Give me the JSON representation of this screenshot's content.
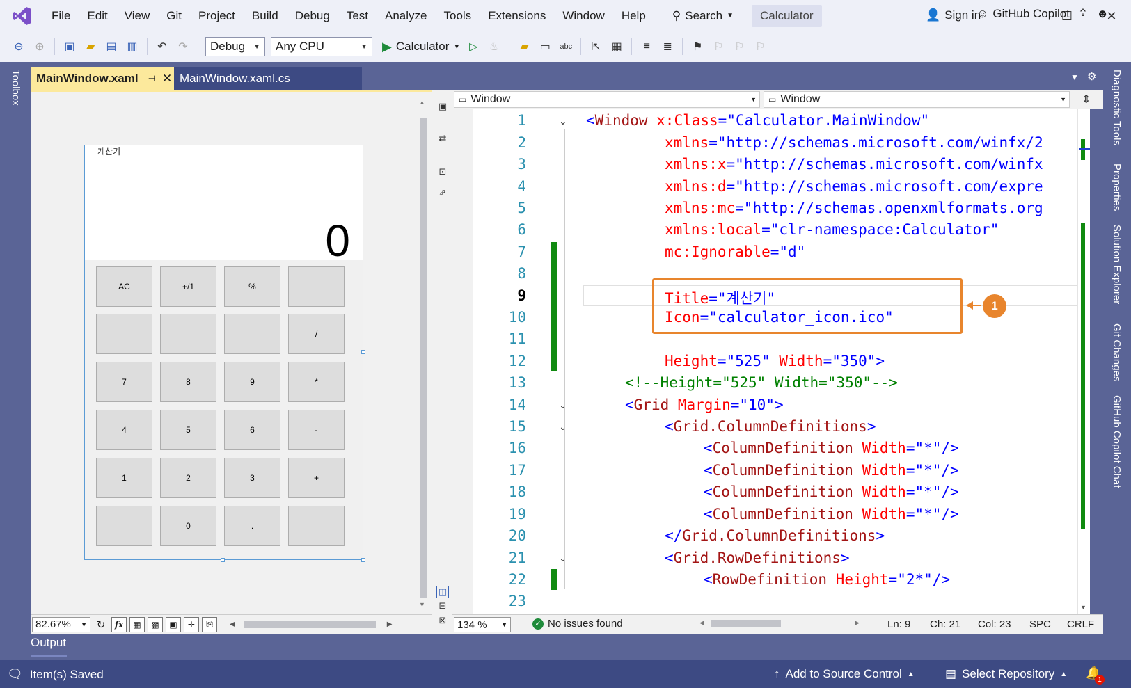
{
  "menu": {
    "items": [
      "File",
      "Edit",
      "View",
      "Git",
      "Project",
      "Build",
      "Debug",
      "Test",
      "Analyze",
      "Tools",
      "Extensions",
      "Window",
      "Help"
    ],
    "search_label": "Search",
    "solution_name": "Calculator",
    "signin_label": "Sign in"
  },
  "toolbar": {
    "config": "Debug",
    "platform": "Any CPU",
    "run_target": "Calculator",
    "copilot_label": "GitHub Copilot"
  },
  "tabs": {
    "active": "MainWindow.xaml",
    "inactive": "MainWindow.xaml.cs"
  },
  "side_labels": {
    "left": "Toolbox",
    "right": [
      "Diagnostic Tools",
      "Properties",
      "Solution Explorer",
      "Git Changes",
      "GitHub Copilot Chat"
    ]
  },
  "designer": {
    "window_title": "계산기",
    "display_value": "0",
    "buttons": [
      "AC",
      "+/1",
      "%",
      "",
      "",
      "",
      "",
      "/",
      "7",
      "8",
      "9",
      "*",
      "4",
      "5",
      "6",
      "-",
      "1",
      "2",
      "3",
      "+",
      "",
      "0",
      ".",
      "="
    ],
    "zoom": "82.67%",
    "fx_label": "fx"
  },
  "editor": {
    "nav_left": "Window",
    "nav_right": "Window",
    "zoom": "134 %",
    "issues": "No issues found",
    "status": {
      "line": "Ln: 9",
      "char": "Ch: 21",
      "col": "Col: 23",
      "spacing": "SPC",
      "eol": "CRLF"
    },
    "callout_number": "1",
    "line_numbers": [
      "1",
      "2",
      "3",
      "4",
      "5",
      "6",
      "7",
      "8",
      "9",
      "10",
      "11",
      "12",
      "13",
      "14",
      "15",
      "16",
      "17",
      "18",
      "19",
      "20",
      "21",
      "22",
      "23"
    ],
    "code": {
      "l1": [
        "<",
        "Window",
        " x:Class",
        "=\"Calculator.MainWindow\""
      ],
      "l2": [
        "xmlns",
        "=\"http://schemas.microsoft.com/winfx/2"
      ],
      "l3": [
        "xmlns",
        ":x",
        "=\"http://schemas.microsoft.com/winfx"
      ],
      "l4": [
        "xmlns",
        ":d",
        "=\"http://schemas.microsoft.com/expre"
      ],
      "l5": [
        "xmlns",
        ":mc",
        "=\"http://schemas.openxmlformats.org"
      ],
      "l6": [
        "xmlns",
        ":local",
        "=\"clr-namespace:Calculator\""
      ],
      "l7": [
        "mc",
        ":Ignorable",
        "=\"d\""
      ],
      "l9": [
        "Title",
        "=\"계산기\""
      ],
      "l10": [
        "Icon",
        "=\"calculator_icon.ico\""
      ],
      "l12": [
        "Height",
        "=\"525\"",
        " Width",
        "=\"350\">"
      ],
      "l13": "<!--Height=\"525\" Width=\"350\"-->",
      "l14": [
        "<",
        "Grid",
        " Margin",
        "=\"10\">"
      ],
      "l15": [
        "<",
        "Grid.ColumnDefinitions",
        ">"
      ],
      "l16": [
        "<",
        "ColumnDefinition",
        " Width",
        "=\"*\"/>"
      ],
      "l20": [
        "</",
        "Grid.ColumnDefinitions",
        ">"
      ],
      "l21": [
        "<",
        "Grid.RowDefinitions",
        ">"
      ],
      "l22": [
        "<",
        "RowDefinition",
        " Height",
        "=\"2*\"/>"
      ]
    }
  },
  "output": {
    "label": "Output"
  },
  "statusbar": {
    "left": "Item(s) Saved",
    "source_control": "Add to Source Control",
    "repo": "Select Repository",
    "notifications": "1"
  }
}
